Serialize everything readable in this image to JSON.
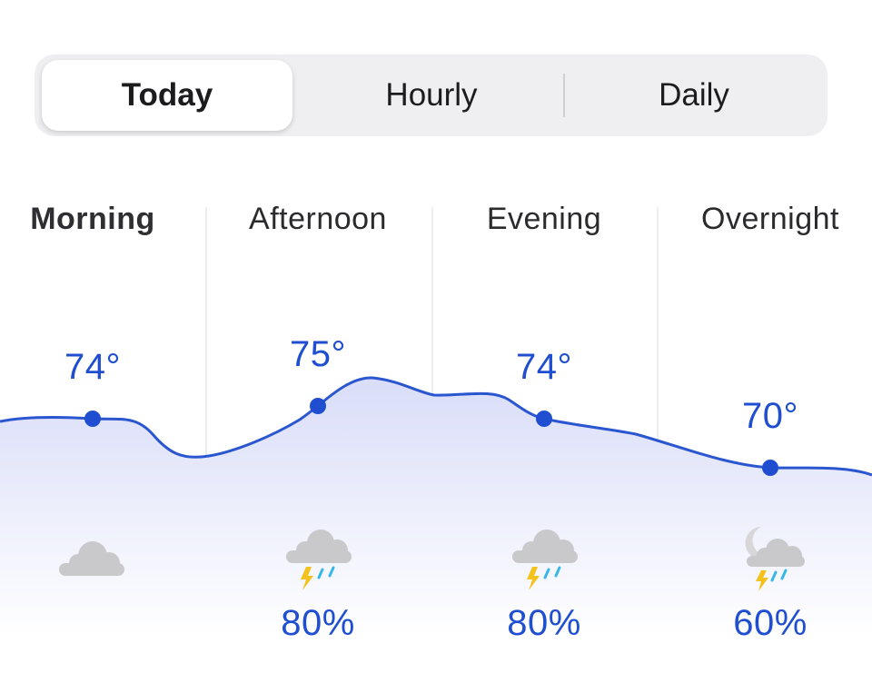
{
  "tabs": [
    {
      "label": "Today",
      "active": true
    },
    {
      "label": "Hourly",
      "active": false
    },
    {
      "label": "Daily",
      "active": false
    }
  ],
  "periods": [
    {
      "name": "Morning",
      "temp": "74°",
      "condition": "cloudy-icon",
      "precip": ""
    },
    {
      "name": "Afternoon",
      "temp": "75°",
      "condition": "thunderstorm-icon",
      "precip": "80%"
    },
    {
      "name": "Evening",
      "temp": "74°",
      "condition": "thunderstorm-icon",
      "precip": "80%"
    },
    {
      "name": "Overnight",
      "temp": "70°",
      "condition": "night-thunderstorm-icon",
      "precip": "60%"
    }
  ],
  "colors": {
    "accent": "#1f4fd0",
    "curve": "#2a56cf",
    "fill_top": "#d9ddf8",
    "cloud": "#c9c9cc",
    "lightning": "#f4c21c",
    "rain": "#39b7e8"
  }
}
